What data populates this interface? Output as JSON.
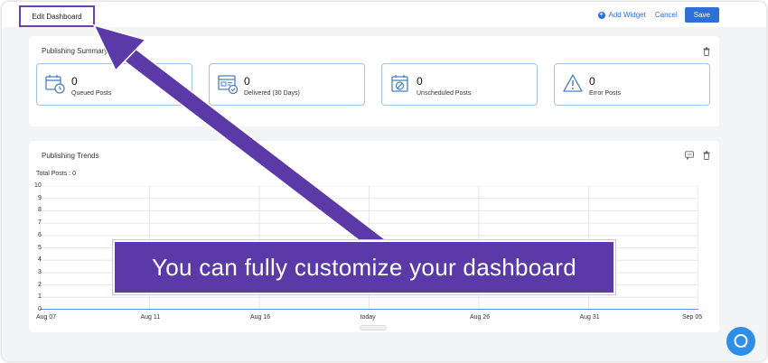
{
  "topbar": {
    "edit_dashboard": "Edit Dashboard",
    "add_widget": "Add Widget",
    "cancel": "Cancel",
    "save": "Save"
  },
  "summary": {
    "title": "Publishing Summary",
    "stats": [
      {
        "value": "0",
        "label": "Queued Posts",
        "icon": "calendar-clock-icon"
      },
      {
        "value": "0",
        "label": "Delivered (30 Days)",
        "icon": "delivered-check-icon"
      },
      {
        "value": "0",
        "label": "Unscheduled Posts",
        "icon": "calendar-slash-icon"
      },
      {
        "value": "0",
        "label": "Error Posts",
        "icon": "warning-triangle-icon"
      }
    ]
  },
  "trends": {
    "title": "Publishing Trends",
    "total_posts": "Total Posts : 0"
  },
  "chart_data": {
    "type": "line",
    "title": "",
    "x": [
      "Aug 07",
      "Aug 11",
      "Aug 16",
      "today",
      "Aug 26",
      "Aug 31",
      "Sep 05"
    ],
    "series": [
      {
        "values": [
          0,
          0,
          0,
          0,
          0,
          0,
          0
        ]
      }
    ],
    "ylim": [
      0,
      10
    ],
    "yticks": [
      "10",
      "9",
      "8",
      "7",
      "6",
      "5",
      "4",
      "3",
      "2",
      "1",
      "0"
    ],
    "grid": true,
    "line_color": "#2f6fd6"
  },
  "banner": {
    "text": "You can fully customize your dashboard"
  },
  "colors": {
    "accent": "#2f6fd6",
    "highlight": "#5b3aa8",
    "card_border": "#9fc4e8"
  }
}
